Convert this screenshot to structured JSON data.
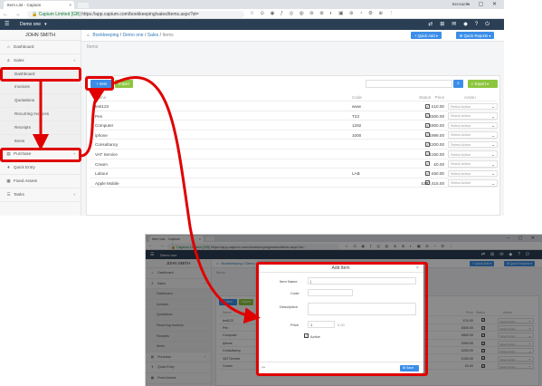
{
  "accent_colors": {
    "brand_dark": "#2a3f54",
    "primary": "#3b8ee8",
    "success": "#8cc63f",
    "highlight": "#e00000"
  },
  "browser": {
    "tab_title": "Item List - Capium",
    "tab_close": "×",
    "profile": "Bensaella",
    "window_controls": "– ▢ ✕",
    "url_org": "Capium Limited [GB]",
    "url": "https://app.capium.com/bookkeeping/sales/items.aspx?st=",
    "url_short": "https://app.capium.com/bookkeeping/sales/items.aspx?st=",
    "extension_icons": [
      "zoom-icon",
      "star-icon",
      "extension-icon",
      "extension-icon",
      "extension-icon",
      "extension-icon",
      "extension-icon",
      "extension-icon",
      "extension-icon",
      "extension-icon",
      "extension-icon",
      "extension-icon",
      "extension-icon",
      "extension-icon",
      "menu-icon"
    ]
  },
  "app": {
    "company": "Demo one",
    "company_caret": "▾",
    "user": "JOHN SMITH",
    "top_icons": [
      "⇄",
      "⊞",
      "✉",
      "◆",
      "?",
      "⏻"
    ]
  },
  "sidebar": {
    "items": [
      {
        "label": "Dashboard",
        "icon": "home-icon",
        "glyph": "⌂"
      },
      {
        "label": "Sales",
        "icon": "currency-icon",
        "glyph": "£",
        "arrow": "‹"
      },
      {
        "label": "Dashboard",
        "sub": true
      },
      {
        "label": "Invoices",
        "sub": true
      },
      {
        "label": "Quotations",
        "sub": true
      },
      {
        "label": "Recurring Invoices",
        "sub": true
      },
      {
        "label": "Receipts",
        "sub": true
      },
      {
        "label": "Items",
        "sub": true
      },
      {
        "label": "Purchase",
        "icon": "cart-icon",
        "glyph": "▤",
        "arrow": "‹"
      },
      {
        "label": "Quick Entry",
        "icon": "plane-icon",
        "glyph": "✈"
      },
      {
        "label": "Fixed Assets",
        "icon": "assets-icon",
        "glyph": "▦"
      },
      {
        "label": "Tasks",
        "icon": "tasks-icon",
        "glyph": "☰",
        "arrow": "‹"
      }
    ]
  },
  "breadcrumb": {
    "home": "⌂",
    "a": "Bookkeeping",
    "sep": "/",
    "b": "Demo one",
    "c": "Sales",
    "d": "Items"
  },
  "header_buttons": {
    "quick_add": "+ Quick Add ▾",
    "quick_reports": "⊞ Quick Reports ▾"
  },
  "page_title": "Items",
  "page_title_right": "⌂ ⊞",
  "toolbar": {
    "add": "+ Item",
    "import": "Import",
    "search_icon": "⌕",
    "export": "⇩ Export ▾"
  },
  "table": {
    "headers": {
      "name": "Name",
      "code": "Code",
      "price": "Price",
      "status": "Status",
      "action": "Action"
    },
    "rows": [
      {
        "name": "test123",
        "code": "www",
        "price": "£10.00",
        "active": true
      },
      {
        "name": "Pen",
        "code": "T23",
        "price": "£500.00",
        "active": true
      },
      {
        "name": "Computer",
        "code": "1292",
        "price": "£800.00",
        "active": true
      },
      {
        "name": "iphone",
        "code": "1000",
        "price": "£999.00",
        "active": true
      },
      {
        "name": "Consultancy",
        "code": "",
        "price": "£200.00",
        "active": true
      },
      {
        "name": "VAT Service",
        "code": "",
        "price": "£150.00",
        "active": true
      },
      {
        "name": "Cream",
        "code": "",
        "price": "£0.00",
        "active": true
      },
      {
        "name": "Labour",
        "code": "LAB",
        "price": "£50.00",
        "active": true
      },
      {
        "name": "Apple Mobile",
        "code": "",
        "price": "£252,415.00",
        "active": true
      }
    ],
    "select_placeholder": "Select Action",
    "select_caret": "⌄",
    "check": "✓"
  },
  "modal": {
    "title": "Add Item",
    "close": "×",
    "item_name_label": "Item Name",
    "item_name_value": "|",
    "code_label": "Code",
    "description_label": "Description",
    "price_label": "Price",
    "price_value": "1",
    "price_suffix": "0.00",
    "active_label": "Active",
    "active_checked": true,
    "save": "⊞ Save",
    "back": "⇦"
  },
  "small_table_rows": [
    {
      "name": "test123",
      "price": "£10.00"
    },
    {
      "name": "Pen",
      "price": "£500.00"
    },
    {
      "name": "Computer",
      "price": "£800.00"
    },
    {
      "name": "iphone",
      "price": "£999.00"
    },
    {
      "name": "Consultancy",
      "price": "£200.00"
    },
    {
      "name": "VAT Service",
      "price": "£150.00"
    },
    {
      "name": "Cream",
      "price": "£0.00"
    }
  ]
}
